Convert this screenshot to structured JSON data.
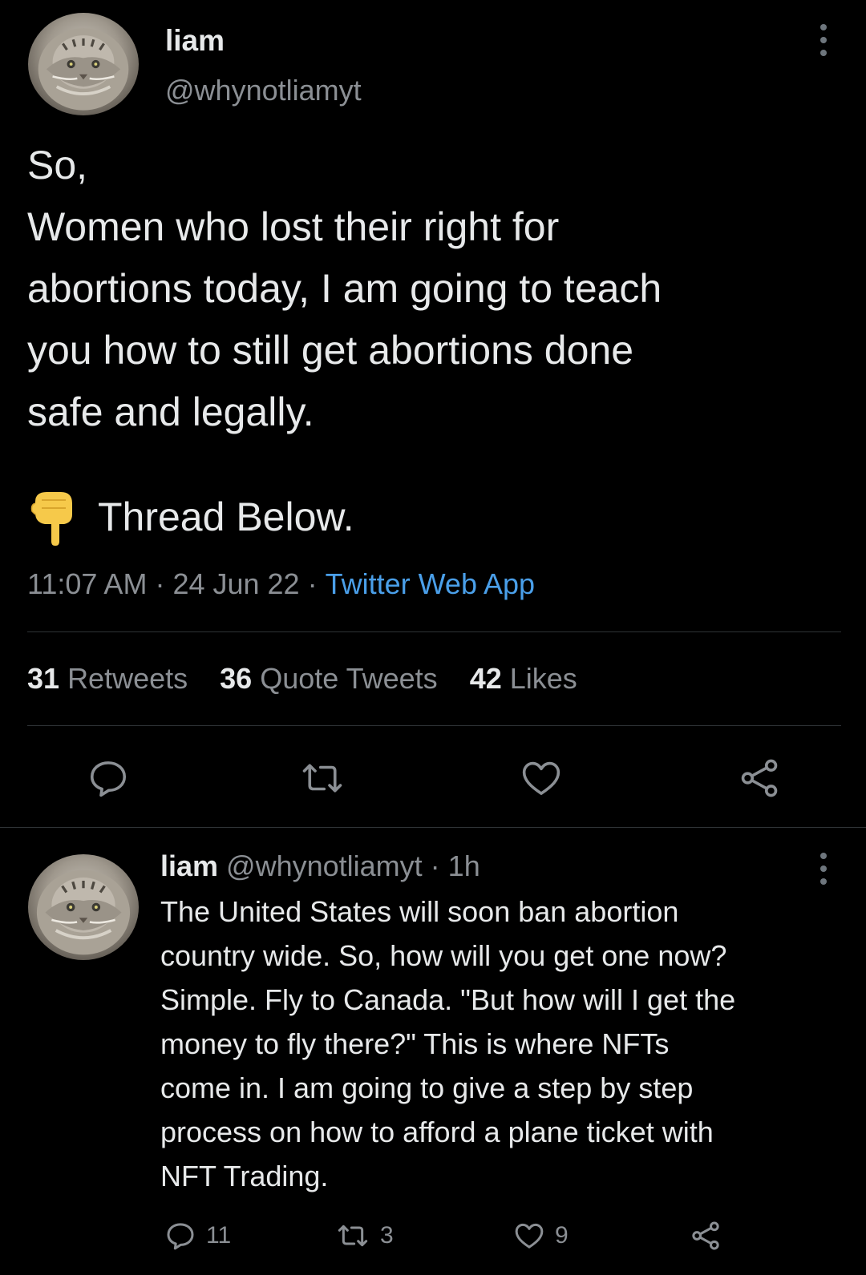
{
  "colors": {
    "background": "#000000",
    "text_primary": "#e7e9ea",
    "text_secondary": "#8b8f94",
    "link": "#4a9fe9",
    "divider": "#2f3336"
  },
  "main_tweet": {
    "avatar_icon": "pallas-cat-avatar",
    "name": "liam",
    "handle": "@whynotliamyt",
    "text": "So,\nWomen who lost their right for\nabortions today, I am going to teach\nyou how to still get abortions done\nsafe and legally.",
    "thread_icon": "backhand-index-pointing-down-emoji",
    "thread_text": "Thread Below.",
    "time": "11:07 AM",
    "date": "24 Jun 22",
    "source": "Twitter Web App",
    "stats": {
      "retweets_count": "31",
      "retweets_label": "Retweets",
      "quotes_count": "36",
      "quotes_label": "Quote Tweets",
      "likes_count": "42",
      "likes_label": "Likes"
    },
    "actions": [
      "reply-icon",
      "retweet-icon",
      "like-icon",
      "share-icon"
    ]
  },
  "reply_tweet": {
    "avatar_icon": "pallas-cat-avatar",
    "name": "liam",
    "handle": "@whynotliamyt",
    "time": "1h",
    "text": "The United States will soon ban abortion\ncountry wide. So, how will you get one now?\nSimple. Fly to Canada. \"But how will I get the\nmoney to fly there?\" This is where NFTs\ncome in. I am going to give a step by step\nprocess on how to afford a plane ticket with\nNFT Trading.",
    "reply_count": "11",
    "retweet_count": "3",
    "like_count": "9"
  },
  "separator": "·"
}
